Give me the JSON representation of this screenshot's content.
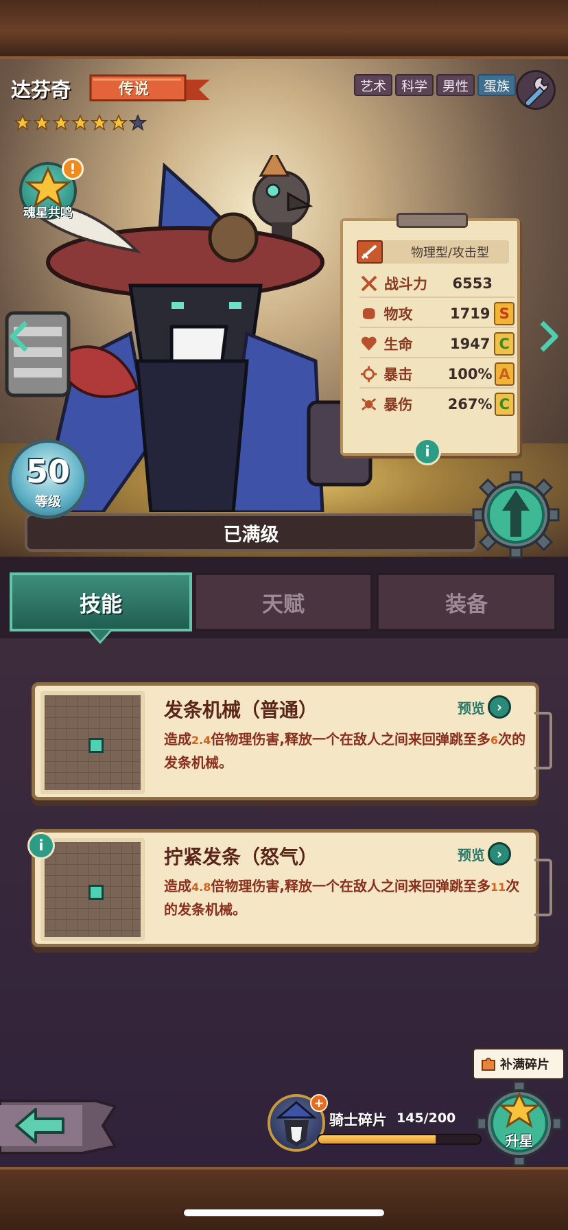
{
  "hero": {
    "name": "达芬奇",
    "rarity": "传说",
    "stars_filled": 6,
    "stars_total": 7,
    "tags": [
      "艺术",
      "科学",
      "男性",
      "蛋族"
    ],
    "resonance_label": "魂星共鸣",
    "resonance_alert": "!",
    "level": "50",
    "level_label": "等级",
    "max_level_text": "已满级"
  },
  "stats": {
    "type": "物理型/攻击型",
    "rows": [
      {
        "name": "战斗力",
        "value": "6553",
        "grade": ""
      },
      {
        "name": "物攻",
        "value": "1719",
        "grade": "S"
      },
      {
        "name": "生命",
        "value": "1947",
        "grade": "C"
      },
      {
        "name": "暴击",
        "value": "100%",
        "grade": "A"
      },
      {
        "name": "暴伤",
        "value": "267%",
        "grade": "C"
      }
    ],
    "info": "i"
  },
  "tabs": [
    "技能",
    "天赋",
    "装备"
  ],
  "active_tab": 0,
  "skills": [
    {
      "title": "发条机械（普通）",
      "preview": "预览",
      "desc_pre": "造成",
      "desc_num": "2.4",
      "desc_mid": "倍物理伤害,释放一个在敌人之间来回弹跳至多",
      "desc_num2": "6",
      "desc_post": "次的发条机械。"
    },
    {
      "title": "拧紧发条（怒气）",
      "preview": "预览",
      "desc_pre": "造成",
      "desc_num": "4.8",
      "desc_mid": "倍物理伤害,释放一个在敌人之间来回弹跳至多",
      "desc_num2": "11",
      "desc_post": "次的发条机械。"
    }
  ],
  "skill_info": "i",
  "shards": {
    "label": "骑士碎片",
    "count": "145/200",
    "progress": 0.725,
    "plus": "+"
  },
  "fill_shards": "补满碎片",
  "star_up": "升星",
  "colors": {
    "accent_teal": "#2c9c84",
    "grade_gold": "#f2b437",
    "rarity_orange": "#e3643a"
  }
}
